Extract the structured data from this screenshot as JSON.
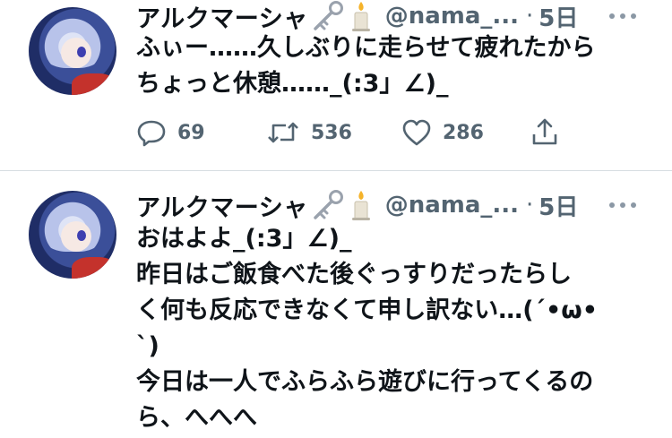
{
  "tweets": [
    {
      "name": "アルクマーシャ",
      "handle": "@nama_...",
      "dot": "·",
      "time": "5日",
      "text": "ふぃー……久しぶりに走らせて疲れたから\nちょっと休憩……_(:3」∠)_",
      "emoji_icons": [
        "key-icon",
        "candle-icon"
      ],
      "stats": {
        "replies": "69",
        "retweets": "536",
        "likes": "286"
      }
    },
    {
      "name": "アルクマーシャ",
      "handle": "@nama_...",
      "dot": "·",
      "time": "5日",
      "text": "おはよよ_(:3」∠)_\n昨日はご飯食べた後ぐっすりだったらし\nく何も反応できなくて申し訳ない…(´•ω•\n`)\n今日は一人でふらふら遊びに行ってくるの\nら、へへへ",
      "emoji_icons": [
        "key-icon",
        "candle-icon"
      ]
    }
  ],
  "colors": {
    "text": "#0f1419",
    "secondary": "#536471",
    "divider": "#d7dde2",
    "accent_red": "#c4322c"
  }
}
